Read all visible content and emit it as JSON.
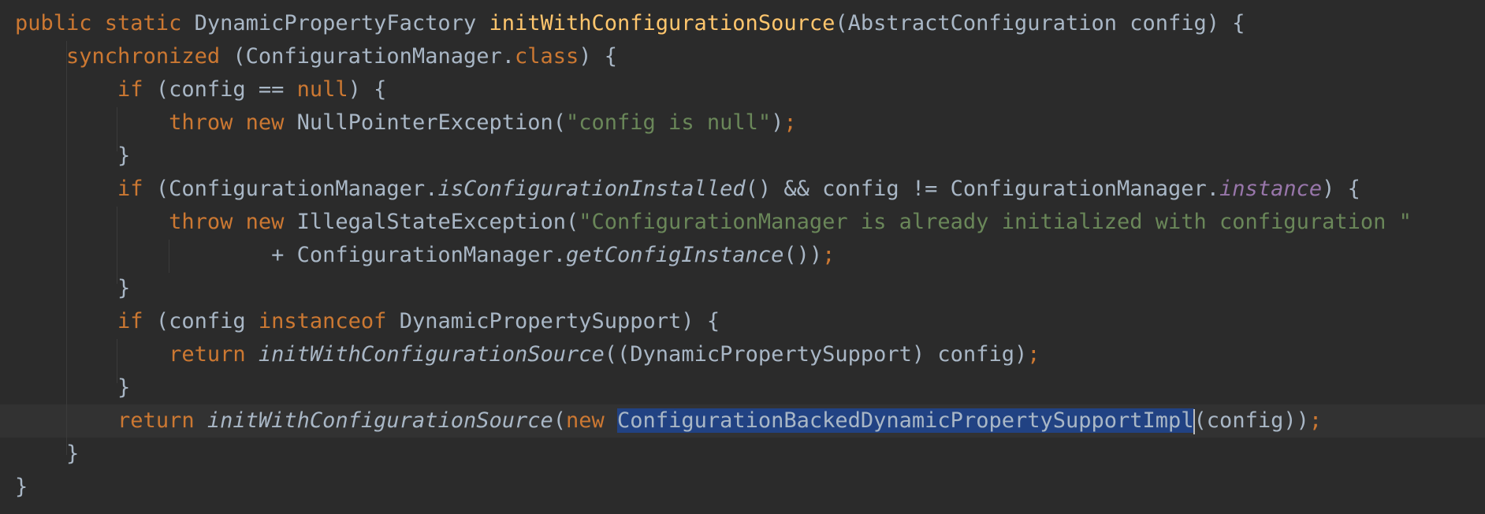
{
  "editor": {
    "lines": [
      [
        {
          "t": "public static ",
          "c": "kw"
        },
        {
          "t": "DynamicPropertyFactory "
        },
        {
          "t": "initWithConfigurationSource",
          "c": "fn-decl"
        },
        {
          "t": "(AbstractConfiguration config) {"
        }
      ],
      [
        {
          "t": "    "
        },
        {
          "t": "synchronized ",
          "c": "kw"
        },
        {
          "t": "(ConfigurationManager."
        },
        {
          "t": "class",
          "c": "kw"
        },
        {
          "t": ") {"
        }
      ],
      [
        {
          "t": "        "
        },
        {
          "t": "if ",
          "c": "kw"
        },
        {
          "t": "(config == "
        },
        {
          "t": "null",
          "c": "kw"
        },
        {
          "t": ") {"
        }
      ],
      [
        {
          "t": "            "
        },
        {
          "t": "throw new ",
          "c": "kw"
        },
        {
          "t": "NullPointerException("
        },
        {
          "t": "\"config is null\"",
          "c": "str"
        },
        {
          "t": ")"
        },
        {
          "t": ";",
          "c": "kw"
        }
      ],
      [
        {
          "t": "        }"
        }
      ],
      [
        {
          "t": "        "
        },
        {
          "t": "if ",
          "c": "kw"
        },
        {
          "t": "(ConfigurationManager."
        },
        {
          "t": "isConfigurationInstalled",
          "c": "static-call"
        },
        {
          "t": "() && config != ConfigurationManager."
        },
        {
          "t": "instance",
          "c": "field"
        },
        {
          "t": ") {"
        }
      ],
      [
        {
          "t": "            "
        },
        {
          "t": "throw new ",
          "c": "kw"
        },
        {
          "t": "IllegalStateException("
        },
        {
          "t": "\"ConfigurationManager is already initialized with configuration \"",
          "c": "str"
        }
      ],
      [
        {
          "t": "                    + ConfigurationManager."
        },
        {
          "t": "getConfigInstance",
          "c": "static-call"
        },
        {
          "t": "())"
        },
        {
          "t": ";",
          "c": "kw"
        }
      ],
      [
        {
          "t": "        }"
        }
      ],
      [
        {
          "t": "        "
        },
        {
          "t": "if ",
          "c": "kw"
        },
        {
          "t": "(config "
        },
        {
          "t": "instanceof ",
          "c": "kw"
        },
        {
          "t": "DynamicPropertySupport) {"
        }
      ],
      [
        {
          "t": "            "
        },
        {
          "t": "return ",
          "c": "kw"
        },
        {
          "t": "initWithConfigurationSource",
          "c": "static-call"
        },
        {
          "t": "((DynamicPropertySupport) config)"
        },
        {
          "t": ";",
          "c": "kw"
        }
      ],
      [
        {
          "t": "        }"
        }
      ],
      [
        {
          "t": "        "
        },
        {
          "t": "return ",
          "c": "kw"
        },
        {
          "t": "initWithConfigurationSource",
          "c": "static-call"
        },
        {
          "t": "("
        },
        {
          "t": "new ",
          "c": "kw"
        },
        {
          "t": "ConfigurationBackedDynamicPropertySupportImpl",
          "c": "sel"
        },
        {
          "t": "",
          "c": "caret"
        },
        {
          "t": "(config))"
        },
        {
          "t": ";",
          "c": "kw"
        }
      ],
      [
        {
          "t": "    }"
        }
      ],
      [
        {
          "t": "}"
        }
      ]
    ],
    "current_line": 12,
    "colors": {
      "background": "#2b2b2b",
      "text": "#a9b7c6",
      "keyword": "#cc7832",
      "method_declaration": "#ffc66d",
      "string": "#6a8759",
      "static_field": "#9876aa",
      "selection": "#214283",
      "current_line": "#323232"
    }
  }
}
